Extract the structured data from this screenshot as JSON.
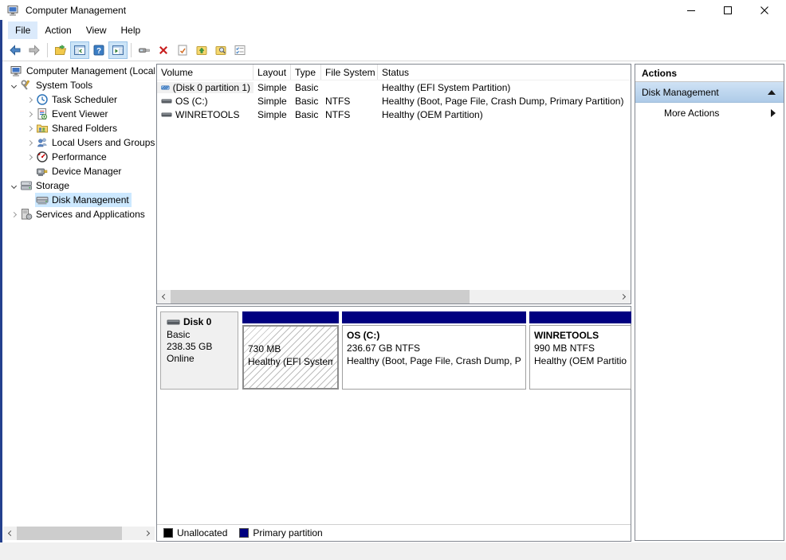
{
  "window": {
    "title": "Computer Management"
  },
  "menu": {
    "items": [
      "File",
      "Action",
      "View",
      "Help"
    ]
  },
  "toolbar": {
    "icons": [
      "back-arrow",
      "forward-arrow",
      "open-folder",
      "show-console-tree",
      "help",
      "show-action-pane",
      "console-window",
      "delete",
      "properties-check",
      "folder-up",
      "folder-search",
      "checklist"
    ]
  },
  "tree": {
    "items": [
      {
        "label": "Computer Management (Local",
        "level": 0,
        "expander": "none",
        "icon": "computer",
        "selected": false
      },
      {
        "label": "System Tools",
        "level": 1,
        "expander": "open",
        "icon": "system-tools",
        "selected": false
      },
      {
        "label": "Task Scheduler",
        "level": 2,
        "expander": "closed",
        "icon": "task-scheduler",
        "selected": false
      },
      {
        "label": "Event Viewer",
        "level": 2,
        "expander": "closed",
        "icon": "event-viewer",
        "selected": false
      },
      {
        "label": "Shared Folders",
        "level": 2,
        "expander": "closed",
        "icon": "shared-folders",
        "selected": false
      },
      {
        "label": "Local Users and Groups",
        "level": 2,
        "expander": "closed",
        "icon": "local-users-groups",
        "selected": false
      },
      {
        "label": "Performance",
        "level": 2,
        "expander": "closed",
        "icon": "performance",
        "selected": false
      },
      {
        "label": "Device Manager",
        "level": 2,
        "expander": "none",
        "icon": "device-manager",
        "selected": false
      },
      {
        "label": "Storage",
        "level": 1,
        "expander": "open",
        "icon": "storage",
        "selected": false
      },
      {
        "label": "Disk Management",
        "level": 2,
        "expander": "none",
        "icon": "disk-management",
        "selected": true
      },
      {
        "label": "Services and Applications",
        "level": 1,
        "expander": "closed",
        "icon": "services-applications",
        "selected": false
      }
    ]
  },
  "volume_table": {
    "columns": [
      "Volume",
      "Layout",
      "Type",
      "File System",
      "Status"
    ],
    "rows": [
      {
        "volume": "(Disk 0 partition 1)",
        "layout": "Simple",
        "type": "Basic",
        "file_system": "",
        "status": "Healthy (EFI System Partition)"
      },
      {
        "volume": "OS (C:)",
        "layout": "Simple",
        "type": "Basic",
        "file_system": "NTFS",
        "status": "Healthy (Boot, Page File, Crash Dump, Primary Partition)"
      },
      {
        "volume": "WINRETOOLS",
        "layout": "Simple",
        "type": "Basic",
        "file_system": "NTFS",
        "status": "Healthy (OEM Partition)"
      }
    ]
  },
  "disk_view": {
    "disk": {
      "name": "Disk 0",
      "type": "Basic",
      "size": "238.35 GB",
      "status": "Online"
    },
    "partitions": [
      {
        "name": "",
        "size": "730 MB",
        "status": "Healthy (EFI System"
      },
      {
        "name": "OS (C:)",
        "size": "236.67 GB NTFS",
        "status": "Healthy (Boot, Page File, Crash Dump, Pri"
      },
      {
        "name": "WINRETOOLS",
        "size": "990 MB NTFS",
        "status": "Healthy (OEM Partitio"
      }
    ]
  },
  "legend": {
    "items": [
      {
        "label": "Unallocated",
        "color": "#000000"
      },
      {
        "label": "Primary partition",
        "color": "#000080"
      }
    ]
  },
  "actions": {
    "header": "Actions",
    "section_title": "Disk Management",
    "more_label": "More Actions"
  },
  "colors": {
    "selection": "#cce8ff",
    "primary_partition": "#000080",
    "window_border": "#24408e"
  }
}
